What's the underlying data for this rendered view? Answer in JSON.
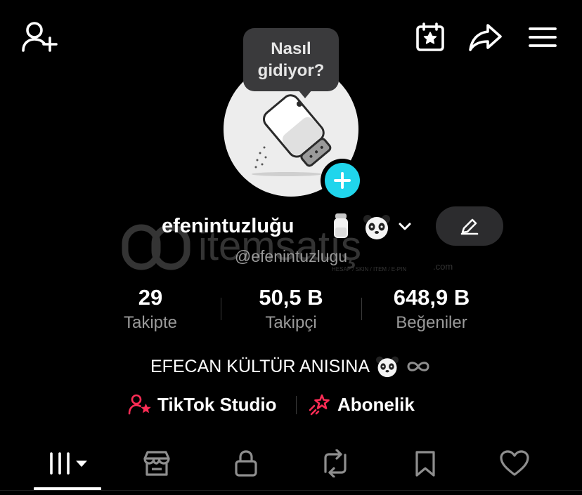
{
  "header": {
    "add_friend_icon": "person-plus-icon",
    "calendar_icon": "calendar-star-icon",
    "share_icon": "share-arrow-icon",
    "menu_icon": "hamburger-menu-icon"
  },
  "profile": {
    "bubble_line1": "Nasıl",
    "bubble_line2": "gidiyor?",
    "display_name": "efenintuzluğu",
    "handle": "@efenintuzlugu",
    "bio": "EFECAN KÜLTÜR ANISINA"
  },
  "stats": [
    {
      "value": "29",
      "label": "Takipte"
    },
    {
      "value": "50,5 B",
      "label": "Takipçi"
    },
    {
      "value": "648,9 B",
      "label": "Beğeniler"
    }
  ],
  "links": {
    "studio": "TikTok Studio",
    "subscription": "Abonelik"
  },
  "watermark": {
    "brand": "itemsatış",
    "tagline": "HESAP / SKIN / ITEM / E-PIN",
    "suffix": ".com"
  },
  "tabs": [
    {
      "name": "videos",
      "icon": "grid-bars-icon",
      "active": true
    },
    {
      "name": "shop",
      "icon": "store-icon",
      "active": false
    },
    {
      "name": "private",
      "icon": "lock-icon",
      "active": false
    },
    {
      "name": "reposts",
      "icon": "repost-icon",
      "active": false
    },
    {
      "name": "saved",
      "icon": "bookmark-icon",
      "active": false
    },
    {
      "name": "liked",
      "icon": "heart-icon",
      "active": false
    }
  ],
  "colors": {
    "background": "#000000",
    "accent_cyan": "#20d5ec",
    "accent_red": "#fe2c55",
    "secondary_text": "#9a9a9a"
  }
}
